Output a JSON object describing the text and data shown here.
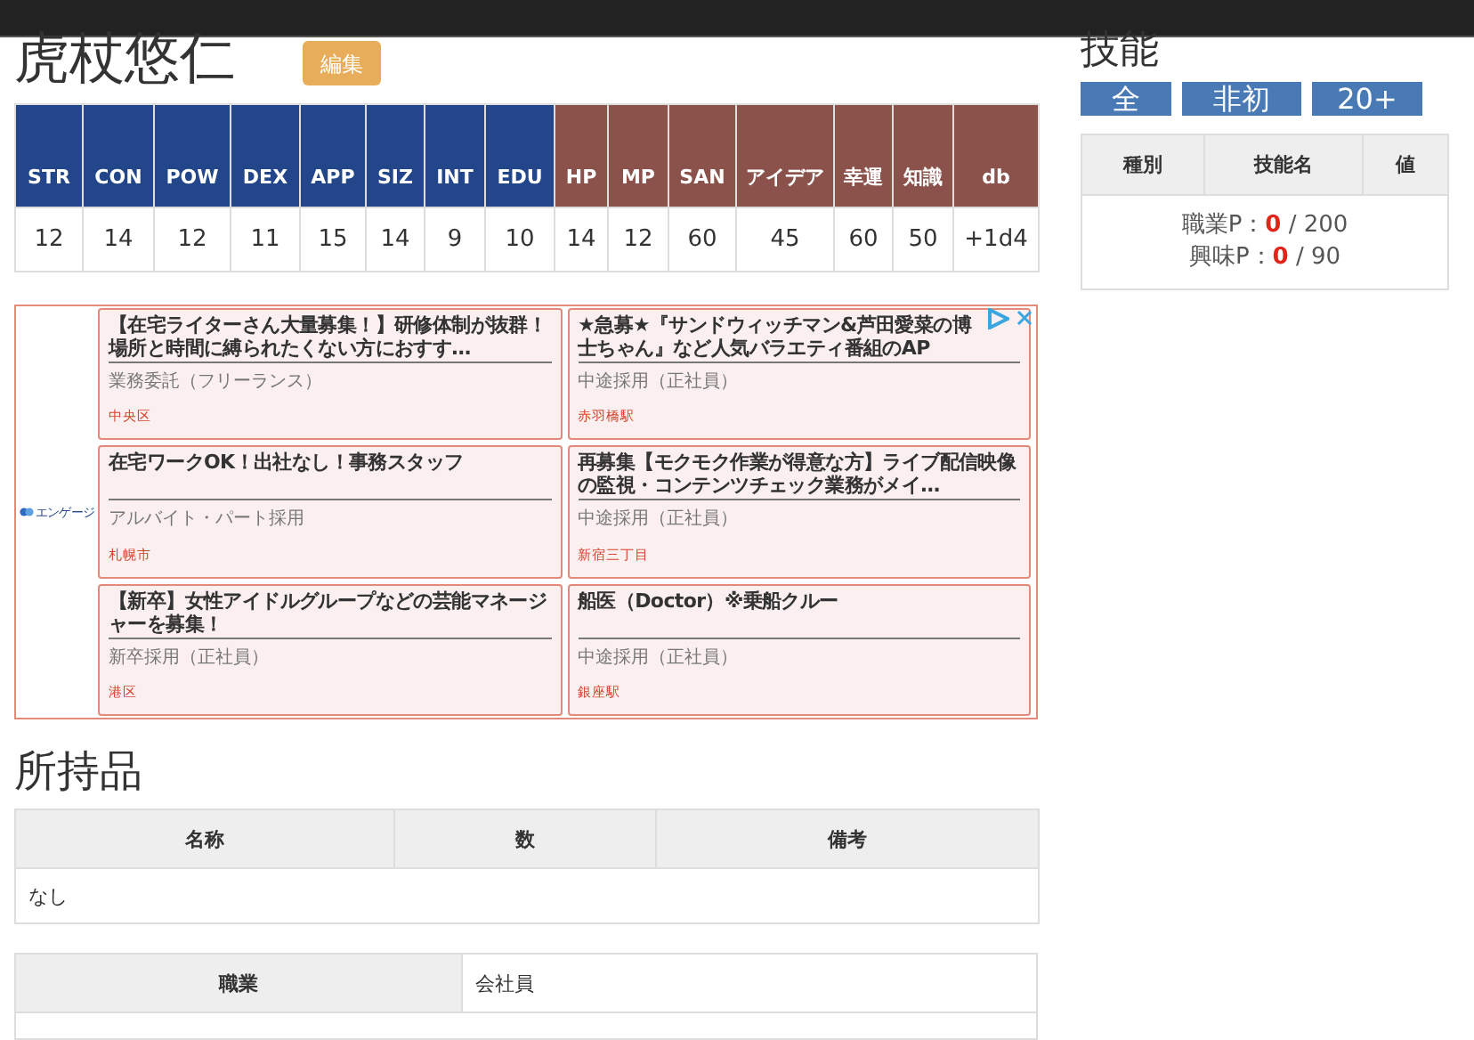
{
  "character": {
    "name": "虎杖悠仁",
    "edit_button": "編集"
  },
  "stats": [
    {
      "label": "STR",
      "value": "12",
      "kind": "base"
    },
    {
      "label": "CON",
      "value": "14",
      "kind": "base"
    },
    {
      "label": "POW",
      "value": "12",
      "kind": "base"
    },
    {
      "label": "DEX",
      "value": "11",
      "kind": "base"
    },
    {
      "label": "APP",
      "value": "15",
      "kind": "base"
    },
    {
      "label": "SIZ",
      "value": "14",
      "kind": "base"
    },
    {
      "label": "INT",
      "value": "9",
      "kind": "base"
    },
    {
      "label": "EDU",
      "value": "10",
      "kind": "base"
    },
    {
      "label": "HP",
      "value": "14",
      "kind": "derived"
    },
    {
      "label": "MP",
      "value": "12",
      "kind": "derived"
    },
    {
      "label": "SAN",
      "value": "60",
      "kind": "derived"
    },
    {
      "label": "アイデア",
      "value": "45",
      "kind": "derived"
    },
    {
      "label": "幸運",
      "value": "60",
      "kind": "derived"
    },
    {
      "label": "知識",
      "value": "50",
      "kind": "derived"
    },
    {
      "label": "db",
      "value": "+1d4",
      "kind": "derived"
    }
  ],
  "ad": {
    "brand": "エンゲージ",
    "jobs": [
      {
        "title": "【在宅ライターさん大量募集！】研修体制が抜群！場所と時間に縛られたくない方におすす…",
        "type": "業務委託（フリーランス）",
        "location": "中央区"
      },
      {
        "title": "★急募★『サンドウィッチマン&芦田愛菜の博士ちゃん』など人気バラエティ番組のAP",
        "type": "中途採用（正社員）",
        "location": "赤羽橋駅"
      },
      {
        "title": "在宅ワークOK！出社なし！事務スタッフ",
        "type": "アルバイト・パート採用",
        "location": "札幌市"
      },
      {
        "title": "再募集【モクモク作業が得意な方】ライブ配信映像の監視・コンテンツチェック業務がメイ…",
        "type": "中途採用（正社員）",
        "location": "新宿三丁目"
      },
      {
        "title": "【新卒】女性アイドルグループなどの芸能マネージャーを募集！",
        "type": "新卒採用（正社員）",
        "location": "港区"
      },
      {
        "title": "船医（Doctor）※乗船クルー",
        "type": "中途採用（正社員）",
        "location": "銀座駅"
      }
    ]
  },
  "items": {
    "title": "所持品",
    "columns": [
      "名称",
      "数",
      "備考"
    ],
    "empty_text": "なし"
  },
  "profile": {
    "label": "職業",
    "value": "会社員"
  },
  "skills": {
    "title": "技能",
    "filters": [
      {
        "label": "全"
      },
      {
        "label": "非初"
      },
      {
        "label": "20+"
      }
    ],
    "columns": [
      "種別",
      "技能名",
      "値"
    ],
    "points": [
      {
        "label": "職業P：",
        "used": "0",
        "total": " / 200"
      },
      {
        "label": "興味P：",
        "used": "0",
        "total": " / 90"
      }
    ]
  }
}
